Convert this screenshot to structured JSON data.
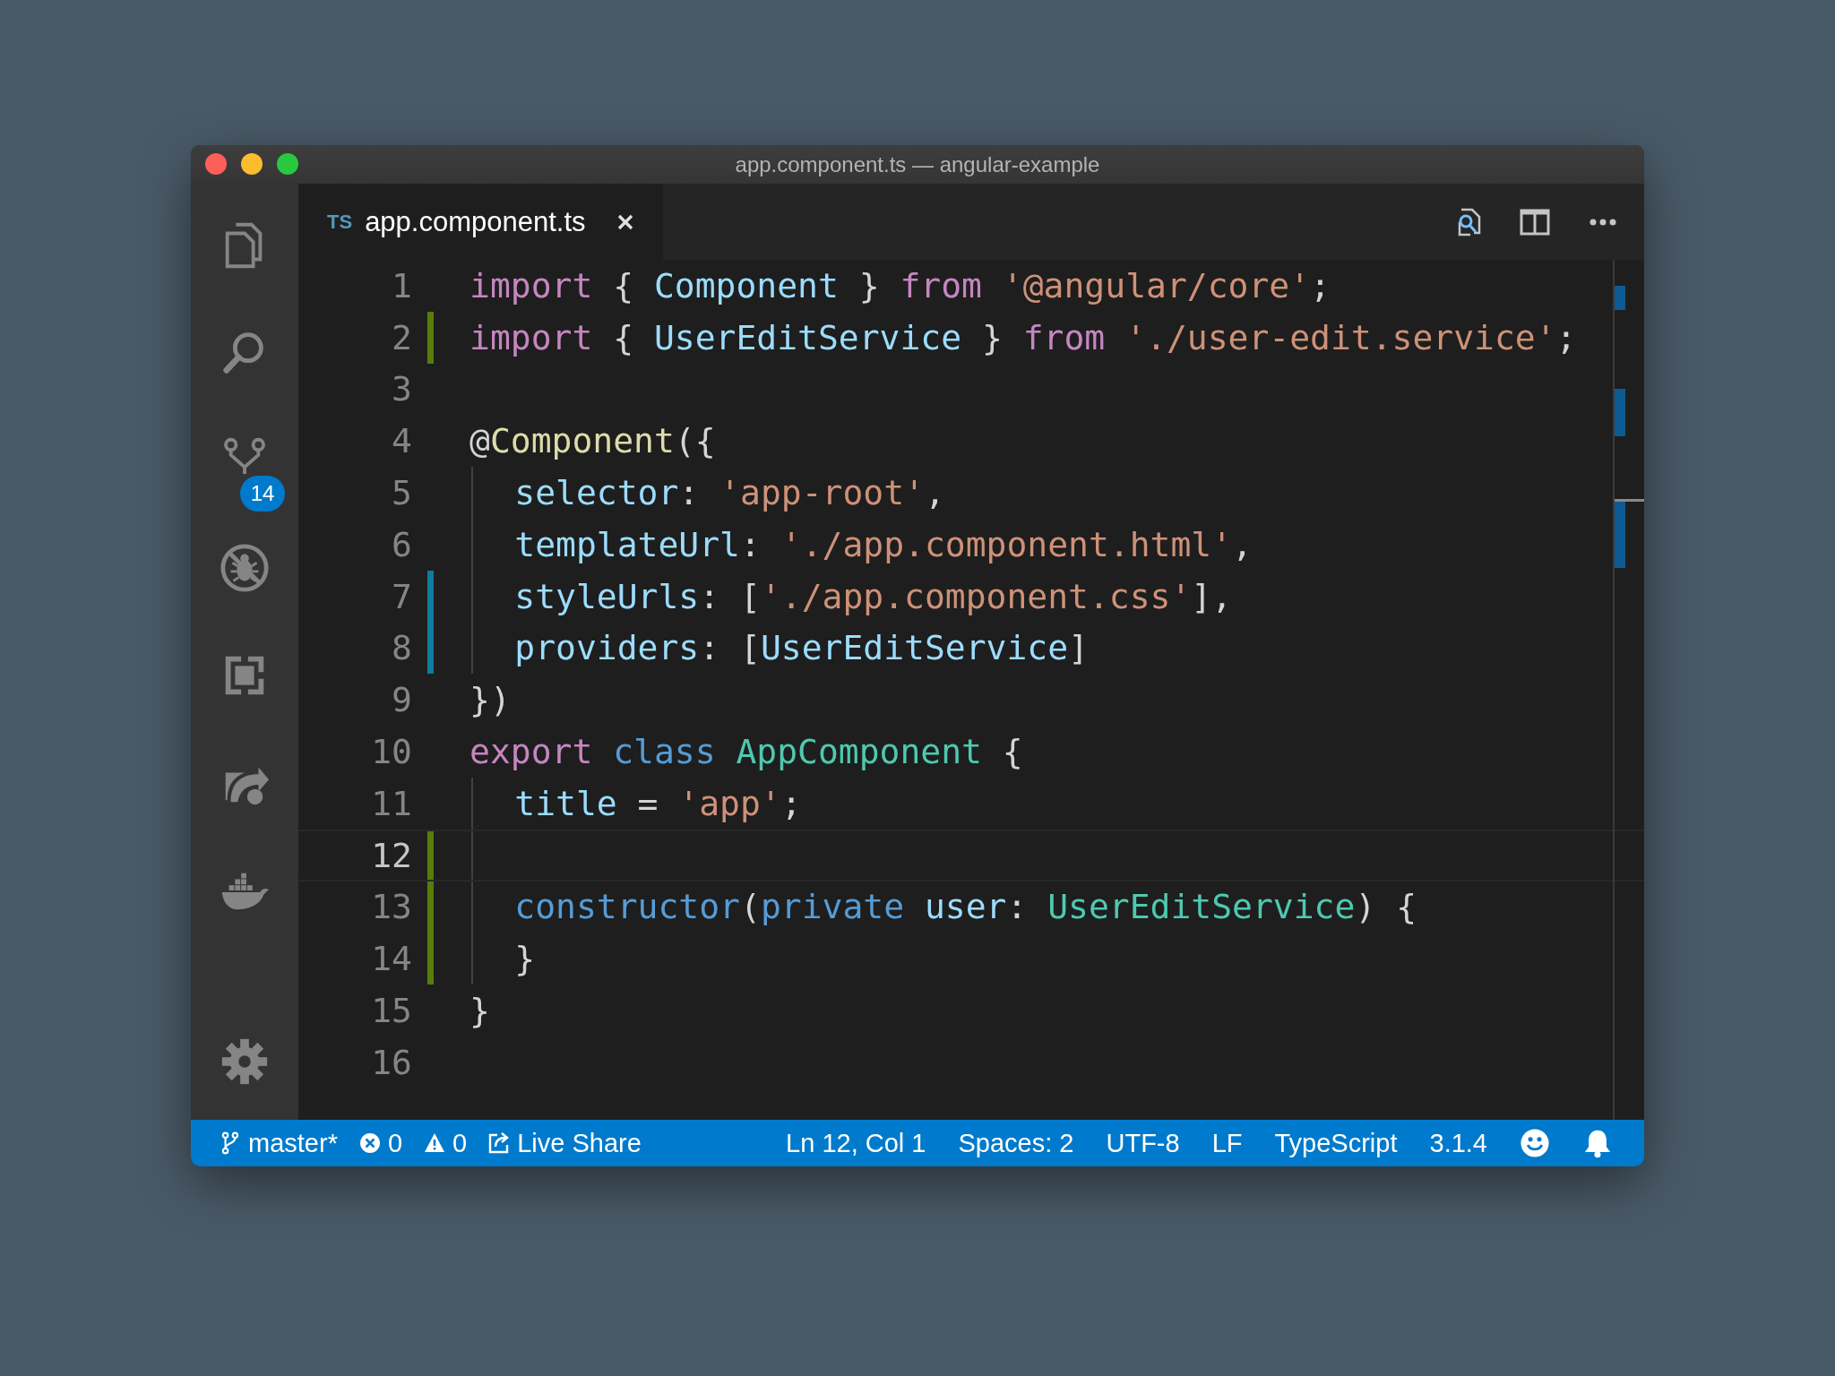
{
  "window": {
    "title": "app.component.ts — angular-example"
  },
  "activity_bar": [
    {
      "kind": "files"
    },
    {
      "kind": "search"
    },
    {
      "kind": "source-control",
      "badge": "14"
    },
    {
      "kind": "debug"
    },
    {
      "kind": "extensions"
    },
    {
      "kind": "live-share"
    },
    {
      "kind": "docker"
    },
    {
      "kind": "settings"
    }
  ],
  "tabs": [
    {
      "icon_text": "TS",
      "label": "app.component.ts",
      "selected": true
    }
  ],
  "editor_actions": [
    {
      "kind": "open-preview"
    },
    {
      "kind": "split"
    },
    {
      "kind": "more"
    }
  ],
  "lines": [
    {
      "number": "1",
      "selected": false,
      "indented": false,
      "tokens": [
        {
          "kind": "keyword",
          "text": "import"
        },
        {
          "kind": "punct",
          "text": " { "
        },
        {
          "kind": "variable",
          "text": "Component"
        },
        {
          "kind": "punct",
          "text": " } "
        },
        {
          "kind": "keyword",
          "text": "from "
        },
        {
          "kind": "string",
          "text": "'@angular/core'"
        },
        {
          "kind": "punct",
          "text": ";"
        }
      ]
    },
    {
      "number": "2",
      "selected": false,
      "indented": false,
      "color": "#587c0c",
      "tokens": [
        {
          "kind": "keyword",
          "text": "import"
        },
        {
          "kind": "punct",
          "text": " { "
        },
        {
          "kind": "variable",
          "text": "UserEditService"
        },
        {
          "kind": "punct",
          "text": " } "
        },
        {
          "kind": "keyword",
          "text": "from "
        },
        {
          "kind": "string",
          "text": "'./user-edit.service'"
        },
        {
          "kind": "punct",
          "text": ";"
        }
      ]
    },
    {
      "number": "3",
      "selected": false,
      "indented": false
    },
    {
      "number": "4",
      "selected": false,
      "indented": false,
      "tokens": [
        {
          "kind": "punct",
          "text": "@"
        },
        {
          "kind": "function",
          "text": "Component"
        },
        {
          "kind": "punct",
          "text": "({"
        }
      ]
    },
    {
      "number": "5",
      "selected": false,
      "indented": true,
      "tokens": [
        {
          "kind": "variable",
          "text": "selector"
        },
        {
          "kind": "punct",
          "text": ": "
        },
        {
          "kind": "string",
          "text": "'app-root'"
        },
        {
          "kind": "punct",
          "text": ","
        }
      ]
    },
    {
      "number": "6",
      "selected": false,
      "indented": true,
      "tokens": [
        {
          "kind": "variable",
          "text": "templateUrl"
        },
        {
          "kind": "punct",
          "text": ": "
        },
        {
          "kind": "string",
          "text": "'./app.component.html'"
        },
        {
          "kind": "punct",
          "text": ","
        }
      ]
    },
    {
      "number": "7",
      "selected": false,
      "indented": true,
      "color": "#0c7d9d",
      "tokens": [
        {
          "kind": "variable",
          "text": "styleUrls"
        },
        {
          "kind": "punct",
          "text": ": ["
        },
        {
          "kind": "string",
          "text": "'./app.component.css'"
        },
        {
          "kind": "punct",
          "text": "],"
        }
      ]
    },
    {
      "number": "8",
      "selected": false,
      "indented": true,
      "color": "#0c7d9d",
      "tokens": [
        {
          "kind": "variable",
          "text": "providers"
        },
        {
          "kind": "punct",
          "text": ": ["
        },
        {
          "kind": "variable",
          "text": "UserEditService"
        },
        {
          "kind": "punct",
          "text": "]"
        }
      ]
    },
    {
      "number": "9",
      "selected": false,
      "indented": false,
      "tokens": [
        {
          "kind": "punct",
          "text": "})"
        }
      ]
    },
    {
      "number": "10",
      "selected": false,
      "indented": false,
      "tokens": [
        {
          "kind": "keyword",
          "text": "export "
        },
        {
          "kind": "storage",
          "text": "class "
        },
        {
          "kind": "class",
          "text": "AppComponent"
        },
        {
          "kind": "punct",
          "text": " {"
        }
      ]
    },
    {
      "number": "11",
      "selected": false,
      "indented": true,
      "tokens": [
        {
          "kind": "variable",
          "text": "title"
        },
        {
          "kind": "punct",
          "text": " = "
        },
        {
          "kind": "string",
          "text": "'app'"
        },
        {
          "kind": "punct",
          "text": ";"
        }
      ]
    },
    {
      "number": "12",
      "selected": true,
      "indented": true,
      "color": "#587c0c"
    },
    {
      "number": "13",
      "selected": false,
      "indented": true,
      "color": "#587c0c",
      "tokens": [
        {
          "kind": "storage",
          "text": "constructor"
        },
        {
          "kind": "punct",
          "text": "("
        },
        {
          "kind": "storage",
          "text": "private "
        },
        {
          "kind": "variable",
          "text": "user"
        },
        {
          "kind": "punct",
          "text": ": "
        },
        {
          "kind": "class",
          "text": "UserEditService"
        },
        {
          "kind": "punct",
          "text": ") {"
        }
      ]
    },
    {
      "number": "14",
      "selected": false,
      "indented": true,
      "color": "#587c0c",
      "tokens": [
        {
          "kind": "punct",
          "text": "}"
        }
      ]
    },
    {
      "number": "15",
      "selected": false,
      "indented": false,
      "tokens": [
        {
          "kind": "punct",
          "text": "}"
        }
      ]
    },
    {
      "number": "16",
      "selected": false,
      "indented": false
    }
  ],
  "status_bar": {
    "left": [
      {
        "kind": "branch",
        "text": "master*"
      },
      {
        "kind": "errors",
        "text": "0"
      },
      {
        "kind": "warnings",
        "text": "0"
      },
      {
        "kind": "live-share",
        "text": "Live Share"
      }
    ],
    "right": [
      {
        "kind": "text",
        "text": "Ln 12, Col 1"
      },
      {
        "kind": "text",
        "text": "Spaces: 2"
      },
      {
        "kind": "text",
        "text": "UTF-8"
      },
      {
        "kind": "text",
        "text": "LF"
      },
      {
        "kind": "text",
        "text": "TypeScript"
      },
      {
        "kind": "text",
        "text": "3.1.4"
      },
      {
        "kind": "feedback"
      },
      {
        "kind": "bell"
      }
    ]
  }
}
